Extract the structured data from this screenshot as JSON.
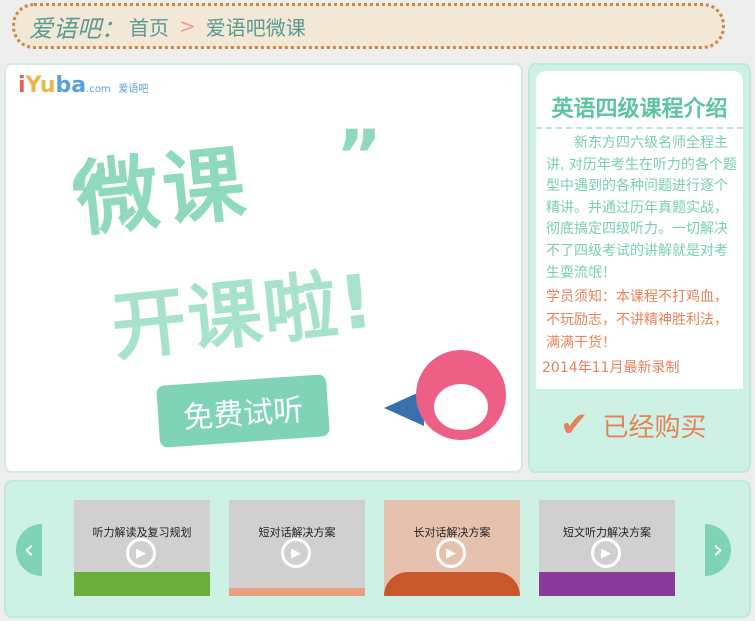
{
  "breadcrumb": {
    "site": "爱语吧：",
    "home": "首页",
    "separator": ">",
    "current": "爱语吧微课"
  },
  "banner": {
    "logo": "iYuba.com",
    "logo_sub": "爱语吧",
    "headline1": "微课",
    "headline2": "开课啦!",
    "trial_button": "免费试听"
  },
  "course": {
    "title": "英语四级课程介绍",
    "intro": "新东方四六级名师全程主讲, 对历年考生在听力的各个题型中遇到的各种问题进行逐个精讲。并通过历年真题实战，彻底搞定四级听力。一切解决不了四级考试的讲解就是对考生耍流氓！",
    "notice": "学员须知：本课程不打鸡血，不玩励志，不讲精神胜利法，满满干货！",
    "date": "2014年11月最新录制",
    "purchased": "已经购买"
  },
  "lessons": [
    {
      "title": "听力解读及复习规划",
      "color": "#6cae3c"
    },
    {
      "title": "短对话解决方案",
      "color": "#e8a080"
    },
    {
      "title": "长对话解决方案",
      "color": "#c8582a"
    },
    {
      "title": "短文听力解决方案",
      "color": "#8a3a9a"
    }
  ],
  "nav": {
    "prev": "‹",
    "next": "›",
    "play": "▶"
  }
}
